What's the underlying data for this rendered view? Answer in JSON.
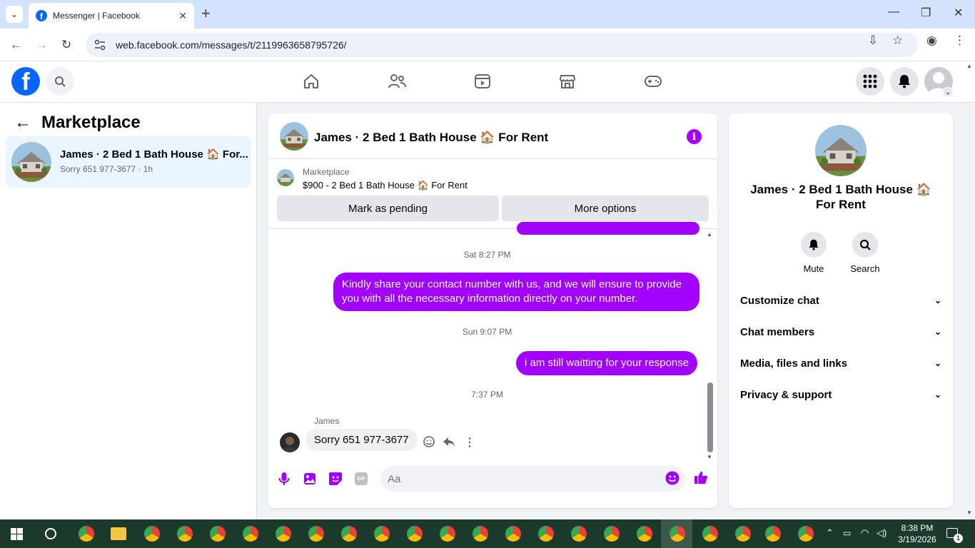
{
  "browser": {
    "tab_title": "Messenger | Facebook",
    "url": "web.facebook.com/messages/t/2119963658795726/"
  },
  "left": {
    "header": "Marketplace",
    "conversation": {
      "name": "James · 2 Bed 1 Bath House 🏠 For...",
      "preview": "Sorry 651 977-3677 · 1h"
    }
  },
  "chat": {
    "title": "James · 2 Bed 1 Bath House 🏠 For Rent",
    "marketplace_label": "Marketplace",
    "listing": "$900 - 2 Bed 1 Bath House 🏠 For Rent",
    "mark_pending_label": "Mark as pending",
    "more_options_label": "More options",
    "messages": [
      {
        "type": "time",
        "text": "Sat 8:27 PM"
      },
      {
        "type": "me",
        "text": "Kindly share your contact number with us, and we will ensure to provide you with all the necessary information directly on your number."
      },
      {
        "type": "time",
        "text": "Sun 9:07 PM"
      },
      {
        "type": "me",
        "text": "i am still waitting for your response"
      },
      {
        "type": "time",
        "text": "7:37 PM"
      },
      {
        "type": "them",
        "sender": "James",
        "text": "Sorry 651 977-3677"
      }
    ],
    "input_placeholder": "Aa"
  },
  "right": {
    "name": "James · 2 Bed 1 Bath House 🏠 For Rent",
    "mute_label": "Mute",
    "search_label": "Search",
    "sections": [
      "Customize chat",
      "Chat members",
      "Media, files and links",
      "Privacy & support"
    ]
  },
  "taskbar": {
    "time": "8:38 PM",
    "date": "3/19/2026",
    "notification_count": "1"
  },
  "colors": {
    "accent": "#a200ff",
    "facebook_blue": "#0866ff",
    "taskbar": "#1c3a2b"
  }
}
